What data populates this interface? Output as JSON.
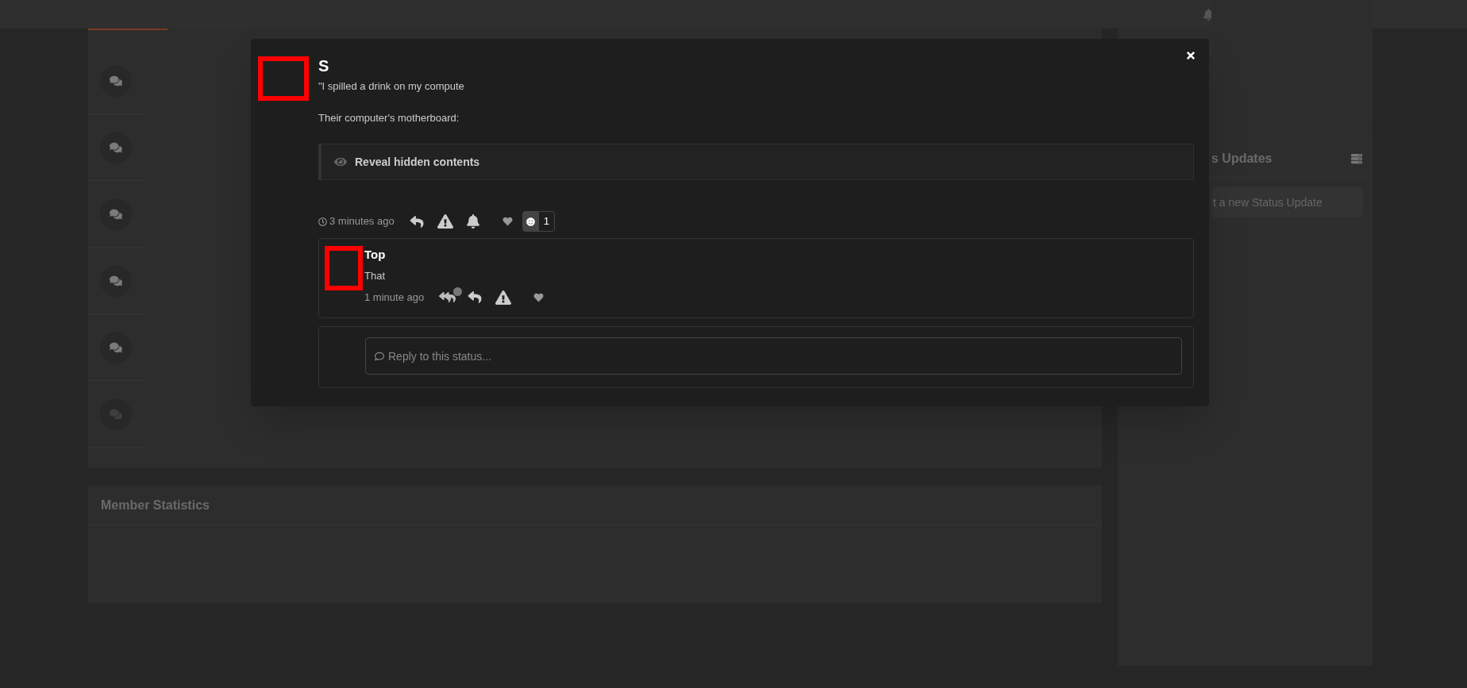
{
  "left_panel": {
    "rows": [
      {
        "faded": false
      },
      {
        "faded": false
      },
      {
        "faded": false
      },
      {
        "faded": false
      },
      {
        "faded": false
      },
      {
        "faded": true
      }
    ]
  },
  "member_statistics": {
    "title": "Member Statistics"
  },
  "sidebar": {
    "title": "s Updates",
    "post_button": "t a new Status Update"
  },
  "modal": {
    "status": {
      "author": "S",
      "quote": "\"I spilled a drink on my compute",
      "text": "Their computer's motherboard:",
      "spoiler": "Reveal hidden contents",
      "time": "3 minutes ago",
      "reaction_count": "1"
    },
    "comments": [
      {
        "author": "Top",
        "text": "That",
        "time": "1 minute ago"
      }
    ],
    "reply": {
      "placeholder": "Reply to this status..."
    }
  }
}
